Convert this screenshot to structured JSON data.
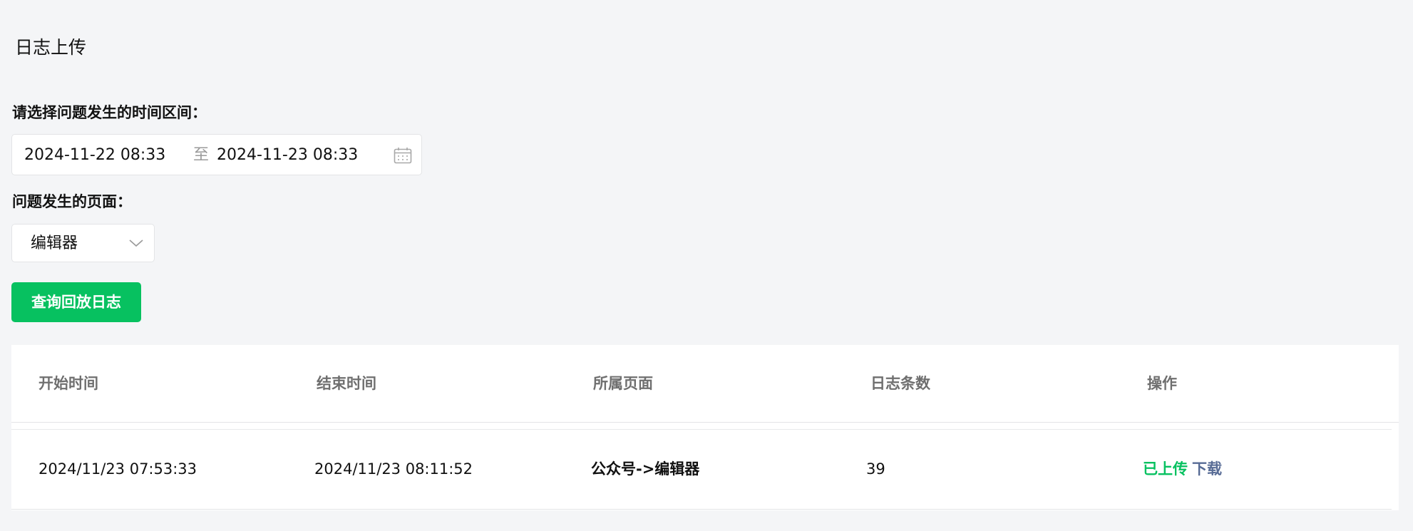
{
  "page": {
    "title": "日志上传"
  },
  "form": {
    "range_label": "请选择问题发生的时间区间：",
    "start_time": "2024-11-22 08:33",
    "separator": "至",
    "end_time": "2024-11-23 08:33",
    "page_label": "问题发生的页面：",
    "page_select_value": "编辑器",
    "query_button_label": "查询回放日志"
  },
  "table": {
    "headers": [
      "开始时间",
      "结束时间",
      "所属页面",
      "日志条数",
      "操作"
    ],
    "rows": [
      {
        "start": "2024/11/23 07:53:33",
        "end": "2024/11/23 08:11:52",
        "page": "公众号->编辑器",
        "count": "39",
        "status": "已上传",
        "action": "下载"
      }
    ]
  },
  "icons": {
    "date_picker": "calendar-icon",
    "select_arrow": "chevron-down-icon"
  },
  "colors": {
    "primary": "#07c160",
    "link": "#576b95",
    "background": "#f4f5f7"
  }
}
